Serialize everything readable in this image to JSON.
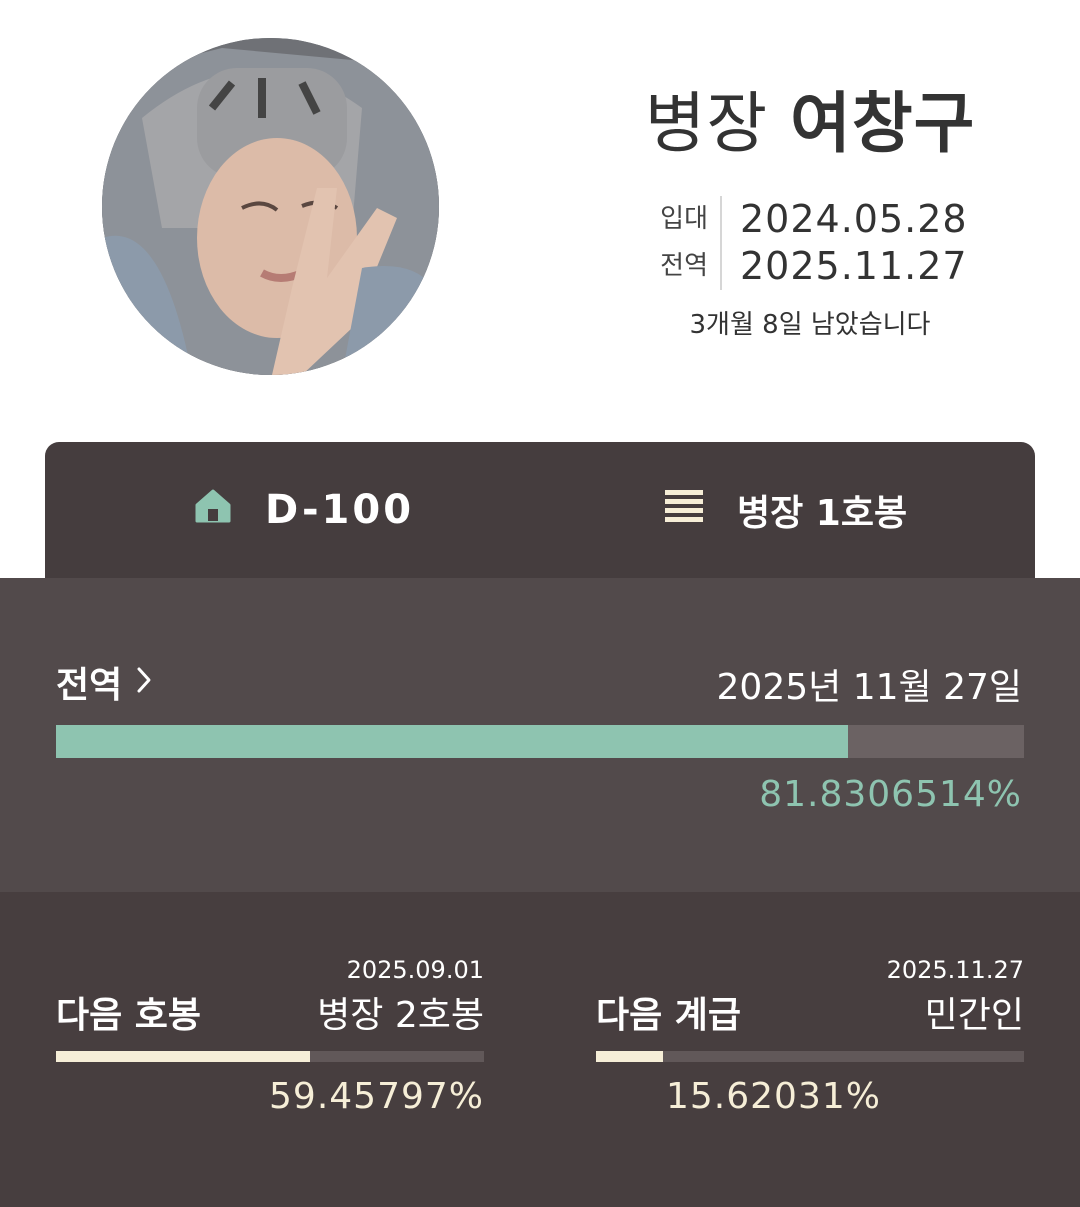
{
  "profile": {
    "rank": "병장",
    "name": "여창구",
    "enlist_label": "입대",
    "enlist_date": "2024.05.28",
    "discharge_label": "전역",
    "discharge_date": "2025.11.27",
    "remaining_text": "3개월 8일 남았습니다",
    "avatar_icon": "profile-photo"
  },
  "tabs": {
    "dday_label": "D-100",
    "dday_icon": "home-icon",
    "rank_label": "병장 1호봉",
    "rank_icon": "menu-icon"
  },
  "discharge": {
    "label": "전역",
    "date_text": "2025년 11월 27일",
    "percent_text": "81.8306514%",
    "progress": 0.818306514
  },
  "next_pay": {
    "title": "다음 호봉",
    "date": "2025.09.01",
    "target": "병장 2호봉",
    "percent_text": "59.45797%",
    "progress": 0.5945797
  },
  "next_rank": {
    "title": "다음 계급",
    "date": "2025.11.27",
    "target": "민간인",
    "percent_text": "15.62031%",
    "progress": 0.1562031
  },
  "colors": {
    "accent_mint": "#8ec4b0",
    "accent_cream": "#f6eed7",
    "panel_dark": "#453d3e",
    "panel_mid": "#524a4b"
  }
}
